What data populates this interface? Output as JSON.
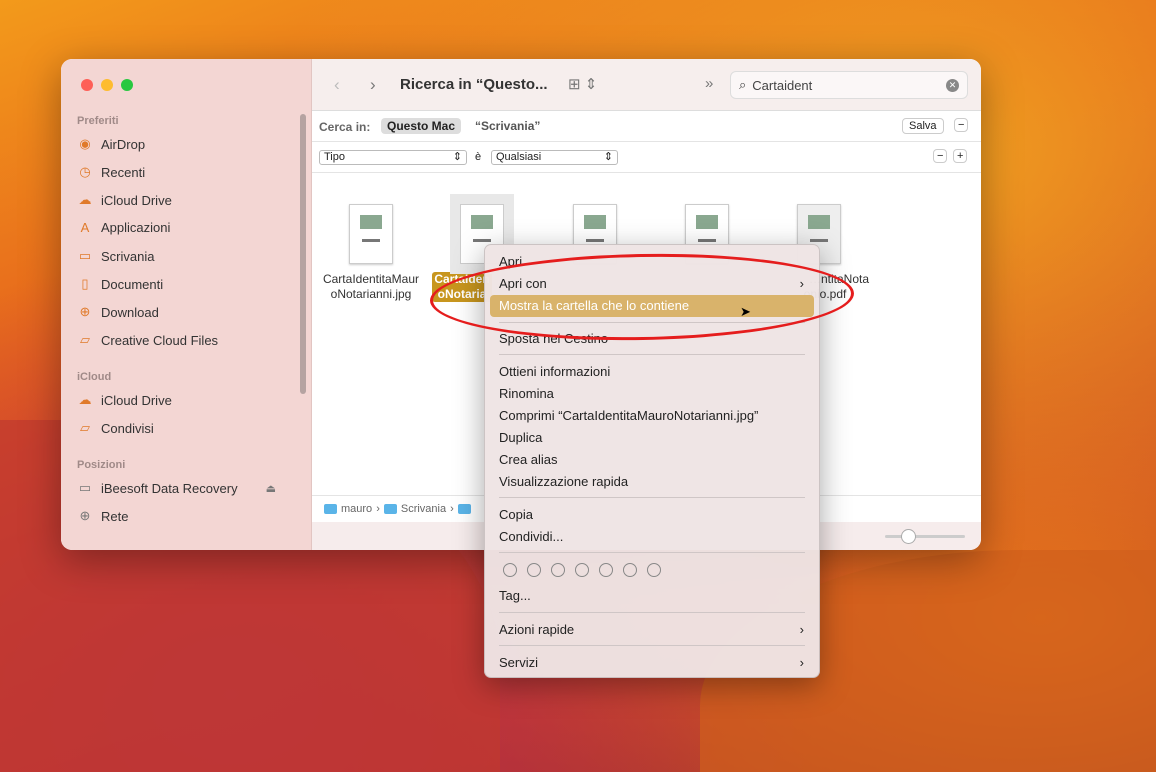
{
  "window": {
    "title": "Ricerca in “Questo...",
    "search_value": "Cartaident"
  },
  "sidebar": {
    "sections": [
      {
        "label": "Preferiti",
        "items": [
          {
            "label": "AirDrop",
            "icon": "airdrop-icon"
          },
          {
            "label": "Recenti",
            "icon": "clock-icon"
          },
          {
            "label": "iCloud Drive",
            "icon": "cloud-icon"
          },
          {
            "label": "Applicazioni",
            "icon": "apps-icon"
          },
          {
            "label": "Scrivania",
            "icon": "desktop-icon"
          },
          {
            "label": "Documenti",
            "icon": "document-icon"
          },
          {
            "label": "Download",
            "icon": "download-icon"
          },
          {
            "label": "Creative Cloud Files",
            "icon": "folder-icon"
          }
        ]
      },
      {
        "label": "iCloud",
        "items": [
          {
            "label": "iCloud Drive",
            "icon": "cloud-icon"
          },
          {
            "label": "Condivisi",
            "icon": "shared-folder-icon"
          }
        ]
      },
      {
        "label": "Posizioni",
        "items": [
          {
            "label": "iBeesoft Data Recovery",
            "icon": "disk-icon"
          },
          {
            "label": "Rete",
            "icon": "globe-icon"
          }
        ]
      }
    ]
  },
  "searchbar": {
    "label": "Cerca in:",
    "scope_active": "Questo Mac",
    "scope_other": "“Scrivania”",
    "save": "Salva"
  },
  "filter": {
    "attribute": "Tipo",
    "operator": "è",
    "value": "Qualsiasi"
  },
  "files": [
    {
      "name": "CartaIdentitaMaur oNotarianni.jpg",
      "selected": false
    },
    {
      "name": "CartaIden oNotaria",
      "selected": true
    },
    {
      "name": "",
      "selected": false
    },
    {
      "name": "",
      "selected": false
    },
    {
      "name": "…ntitaNota …onio.pdf",
      "selected": false
    }
  ],
  "pathbar": [
    "mauro",
    "Scrivania"
  ],
  "menu": {
    "items": [
      "Apri",
      "Apri con",
      "Mostra la cartella che lo contiene",
      "Sposta nel Cestino",
      "Ottieni informazioni",
      "Rinomina",
      "Comprimi “CartaIdentitaMauroNotarianni.jpg”",
      "Duplica",
      "Crea alias",
      "Visualizzazione rapida",
      "Copia",
      "Condividi...",
      "Tag...",
      "Azioni rapide",
      "Servizi"
    ],
    "highlighted": "Mostra la cartella che lo contiene",
    "highlight_color": "#d9b36b"
  },
  "colors": {
    "annotation": "#e51d1d",
    "selection": "#c8961e"
  }
}
